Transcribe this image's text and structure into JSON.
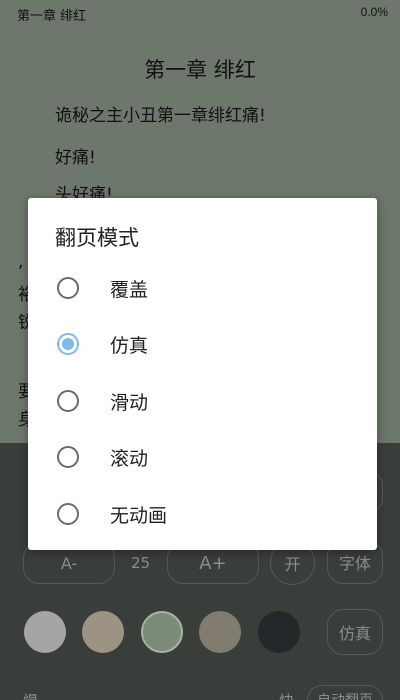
{
  "status": {
    "chapter": "第一章 绯红",
    "progress": "0.0%"
  },
  "reader": {
    "title": "第一章 绯红",
    "paragraphs": [
      "诡秘之主小丑第一章绯红痛!",
      "好痛!",
      "头好痛!"
    ],
    "fragments": [
      ",",
      "裕",
      "锐",
      "要",
      "身"
    ]
  },
  "panel": {
    "font_minus": "A-",
    "font_size": "25",
    "font_plus": "A+",
    "toggle_label": "开",
    "font_button": "字体",
    "page_mode_button": "仿真",
    "bottom_left": "慢",
    "bottom_mid": "快",
    "auto_page_button": "自动翻页",
    "swatch_colors": [
      "#a5a5a7",
      "#9c9383",
      "#7d8b79",
      "#807d70",
      "#25282a"
    ]
  },
  "dialog": {
    "title": "翻页模式",
    "options": [
      {
        "label": "覆盖",
        "selected": false
      },
      {
        "label": "仿真",
        "selected": true
      },
      {
        "label": "滑动",
        "selected": false
      },
      {
        "label": "滚动",
        "selected": false
      },
      {
        "label": "无动画",
        "selected": false
      }
    ]
  }
}
